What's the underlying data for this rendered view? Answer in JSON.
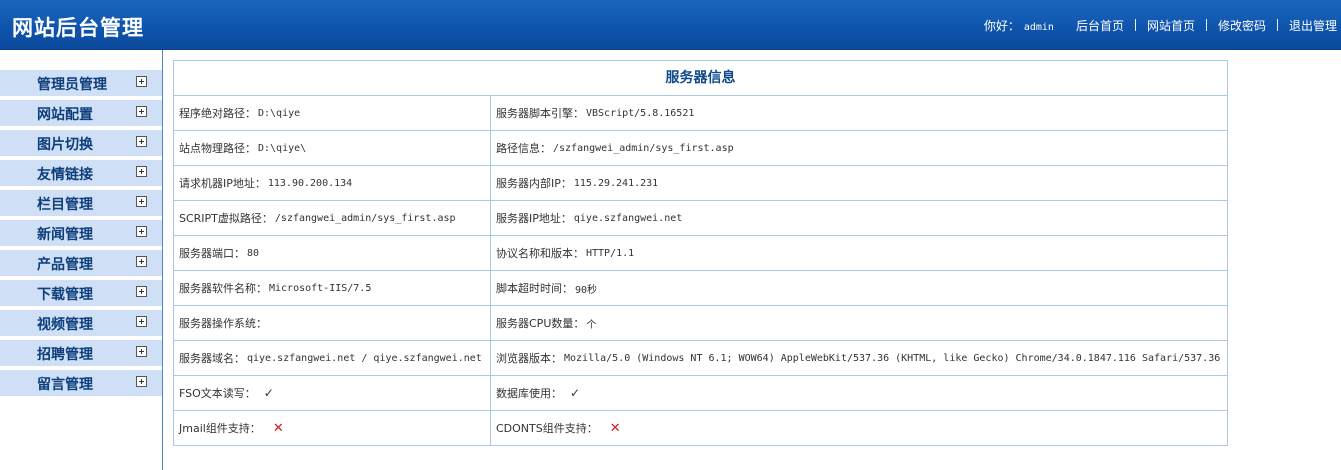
{
  "header": {
    "title": "网站后台管理",
    "greeting_label": "你好：",
    "username": "admin",
    "nav": [
      {
        "label": "后台首页"
      },
      {
        "label": "网站首页"
      },
      {
        "label": "修改密码"
      },
      {
        "label": "退出管理"
      }
    ]
  },
  "sidebar": {
    "items": [
      {
        "label": "管理员管理",
        "icon": "plus-box-icon"
      },
      {
        "label": "网站配置",
        "icon": "plus-box-icon"
      },
      {
        "label": "图片切换",
        "icon": "plus-box-icon"
      },
      {
        "label": "友情链接",
        "icon": "plus-box-icon"
      },
      {
        "label": "栏目管理",
        "icon": "plus-box-icon"
      },
      {
        "label": "新闻管理",
        "icon": "plus-box-icon"
      },
      {
        "label": "产品管理",
        "icon": "plus-box-icon"
      },
      {
        "label": "下载管理",
        "icon": "plus-box-icon"
      },
      {
        "label": "视频管理",
        "icon": "plus-box-icon"
      },
      {
        "label": "招聘管理",
        "icon": "plus-box-icon"
      },
      {
        "label": "留言管理",
        "icon": "plus-box-icon"
      }
    ]
  },
  "server_info": {
    "title": "服务器信息",
    "rows": [
      {
        "left": {
          "label": "程序绝对路径：",
          "value": "D:\\qiye"
        },
        "right": {
          "label": "服务器脚本引擎：",
          "value": "VBScript/5.8.16521"
        }
      },
      {
        "left": {
          "label": "站点物理路径：",
          "value": "D:\\qiye\\"
        },
        "right": {
          "label": "路径信息：",
          "value": "/szfangwei_admin/sys_first.asp"
        }
      },
      {
        "left": {
          "label": "请求机器IP地址：",
          "value": "113.90.200.134"
        },
        "right": {
          "label": "服务器内部IP：",
          "value": "115.29.241.231"
        }
      },
      {
        "left": {
          "label": "SCRIPT虚拟路径：",
          "value": "/szfangwei_admin/sys_first.asp"
        },
        "right": {
          "label": "服务器IP地址：",
          "value": "qiye.szfangwei.net"
        }
      },
      {
        "left": {
          "label": "服务器端口：",
          "value": "80"
        },
        "right": {
          "label": "协议名称和版本：",
          "value": "HTTP/1.1"
        }
      },
      {
        "left": {
          "label": "服务器软件名称：",
          "value": "Microsoft-IIS/7.5"
        },
        "right": {
          "label": "脚本超时时间：",
          "value": "90秒"
        }
      },
      {
        "left": {
          "label": "服务器操作系统：",
          "value": ""
        },
        "right": {
          "label": "服务器CPU数量：",
          "value": "个"
        }
      },
      {
        "left": {
          "label": "服务器域名：",
          "value": "qiye.szfangwei.net / qiye.szfangwei.net"
        },
        "right": {
          "label": "浏览器版本：",
          "value": "Mozilla/5.0 (Windows NT 6.1; WOW64) AppleWebKit/537.36 (KHTML, like Gecko) Chrome/34.0.1847.116 Safari/537.36"
        }
      }
    ],
    "support_rows": [
      {
        "left": {
          "label": "FSO文本读写：",
          "status": "supported",
          "glyph": "✓"
        },
        "right": {
          "label": "数据库使用：",
          "status": "supported",
          "glyph": "✓"
        }
      },
      {
        "left": {
          "label": "Jmail组件支持：",
          "status": "unsupported",
          "glyph": "✕"
        },
        "right": {
          "label": "CDONTS组件支持：",
          "status": "unsupported",
          "glyph": "✕"
        }
      }
    ]
  },
  "colors": {
    "header_blue": "#0f55ad",
    "sidebar_item_bg": "#cfe0f6",
    "sidebar_text": "#0d3d7a",
    "table_border": "#a9c9e6",
    "title_text": "#0f4a8a",
    "cross_red": "#d61a1a"
  }
}
